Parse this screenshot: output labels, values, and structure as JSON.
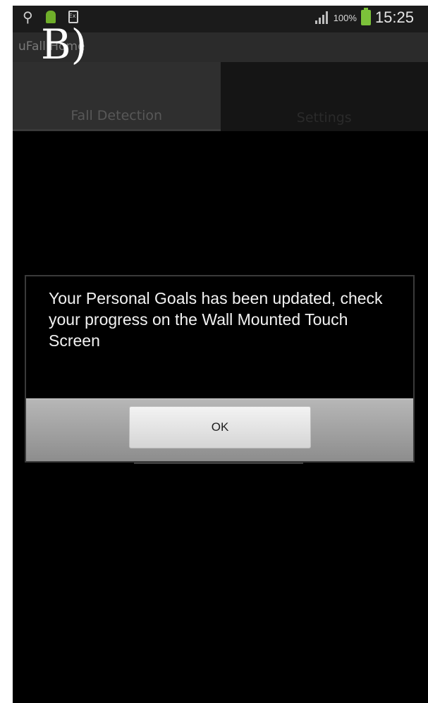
{
  "status_bar": {
    "battery_percent": "100%",
    "time": "15:25",
    "icons": [
      "usb-icon",
      "android-icon",
      "sim-icon",
      "signal-icon",
      "battery-icon"
    ]
  },
  "figure_label": "B)",
  "title_bar": {
    "title": "uFall Home"
  },
  "tabs": [
    {
      "label": "Fall Detection",
      "active": true
    },
    {
      "label": "Settings",
      "active": false
    }
  ],
  "dialog": {
    "message": "Your Personal Goals has been updated, check your progress on the Wall Mounted Touch Screen",
    "ok_label": "OK"
  }
}
